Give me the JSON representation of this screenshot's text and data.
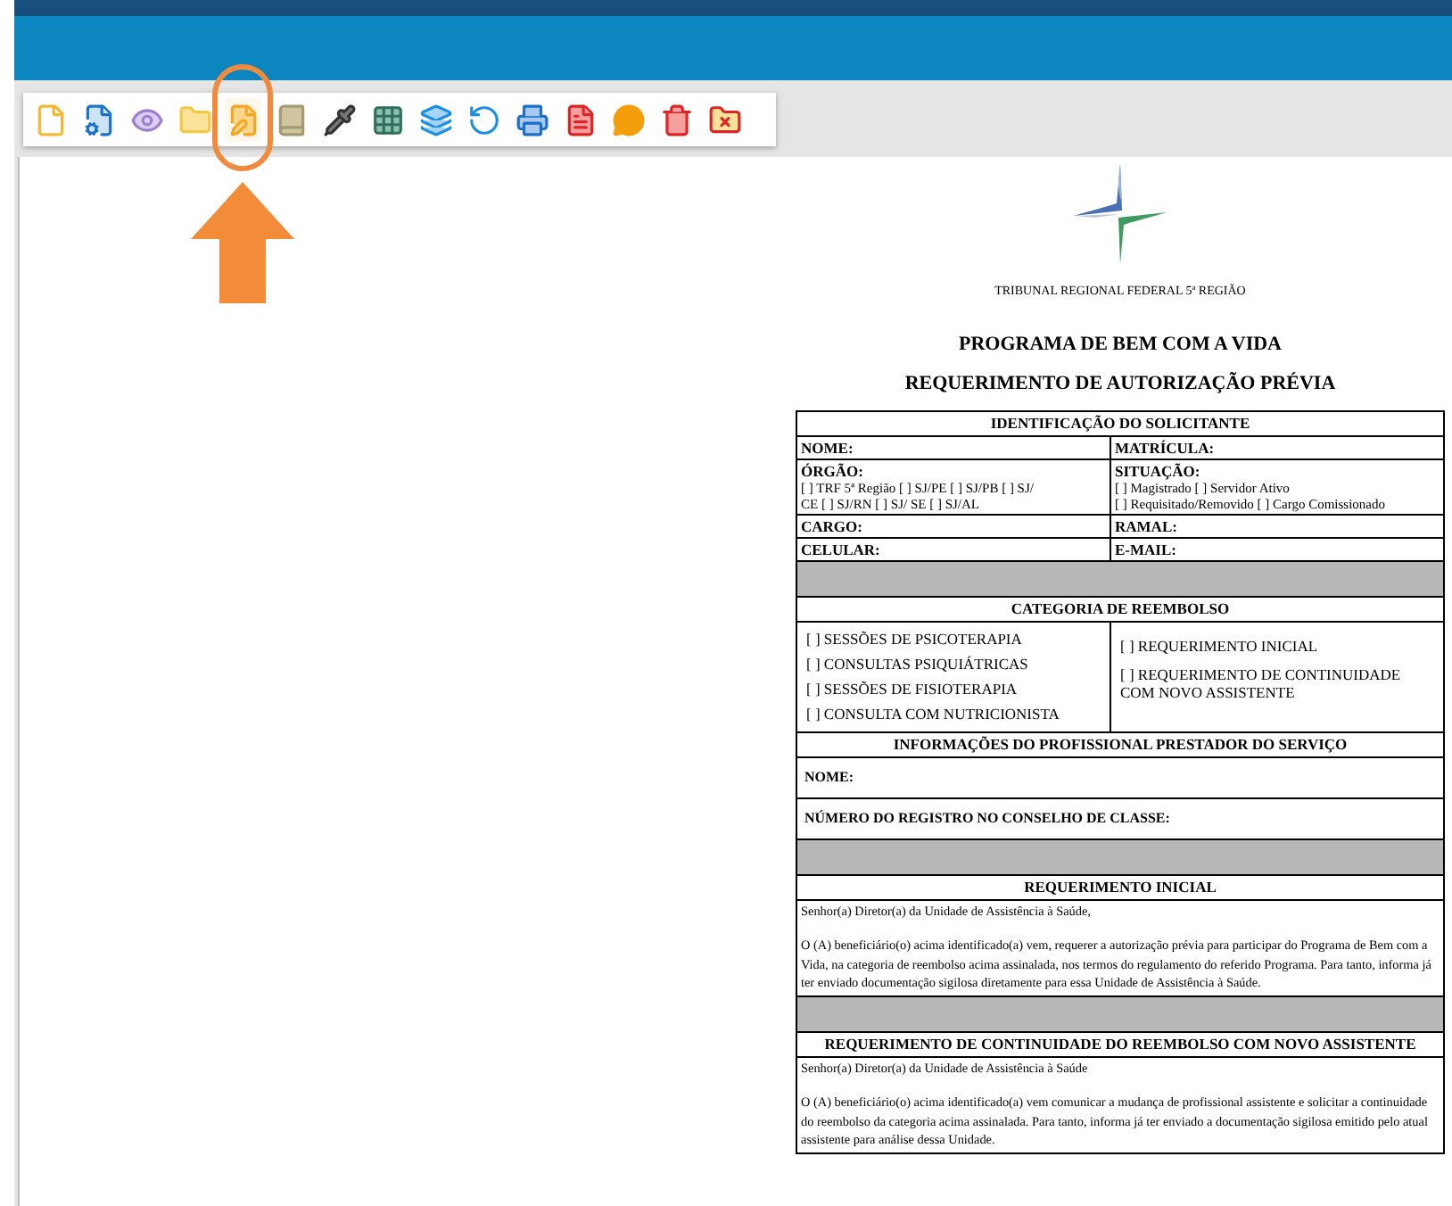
{
  "toolbar": {
    "items": [
      {
        "kind": "new",
        "highlighted": false
      },
      {
        "kind": "settings",
        "highlighted": false
      },
      {
        "kind": "view",
        "highlighted": false
      },
      {
        "kind": "folder-info",
        "highlighted": false
      },
      {
        "kind": "edit",
        "highlighted": true
      },
      {
        "kind": "book",
        "highlighted": false
      },
      {
        "kind": "pipette",
        "highlighted": false
      },
      {
        "kind": "pipette-grid",
        "highlighted": false
      },
      {
        "kind": "layers",
        "highlighted": false
      },
      {
        "kind": "refresh",
        "highlighted": false
      },
      {
        "kind": "print",
        "highlighted": false
      },
      {
        "kind": "pdf",
        "highlighted": false
      },
      {
        "kind": "comment",
        "highlighted": false
      },
      {
        "kind": "delete",
        "highlighted": false
      },
      {
        "kind": "folder-remove",
        "highlighted": false
      }
    ]
  },
  "document": {
    "org": "TRIBUNAL REGIONAL FEDERAL 5ª REGIÃO",
    "title": "PROGRAMA DE BEM COM A VIDA",
    "subtitle": "REQUERIMENTO DE AUTORIZAÇÃO PRÉVIA",
    "sections": [
      {
        "kind": "header",
        "text": "IDENTIFICAÇÃO DO SOLICITANTE"
      },
      {
        "kind": "pair",
        "left": {
          "label": "NOME:"
        },
        "right": {
          "label": "MATRÍCULA:"
        }
      },
      {
        "kind": "pair",
        "left": {
          "label": "ÓRGÃO:",
          "lines": [
            "[ ] TRF 5ª Região [ ] SJ/PE [ ] SJ/PB [ ] SJ/",
            "CE [ ] SJ/RN [ ] SJ/ SE [ ] SJ/AL"
          ]
        },
        "right": {
          "label": "SITUAÇÃO:",
          "lines": [
            "[ ] Magistrado  [ ] Servidor Ativo",
            "[ ] Requisitado/Removido [ ] Cargo Comissionado"
          ]
        }
      },
      {
        "kind": "pair",
        "left": {
          "label": "CARGO:"
        },
        "right": {
          "label": "RAMAL:"
        }
      },
      {
        "kind": "pair",
        "left": {
          "label": "CELULAR:"
        },
        "right": {
          "label": "E-MAIL:"
        }
      },
      {
        "kind": "shaded"
      },
      {
        "kind": "header",
        "text": "CATEGORIA DE REEMBOLSO"
      },
      {
        "kind": "options",
        "left": [
          "[ ] SESSÕES DE PSICOTERAPIA",
          "[ ] CONSULTAS PSIQUIÁTRICAS",
          "[ ] SESSÕES DE FISIOTERAPIA",
          "[ ] CONSULTA COM NUTRICIONISTA"
        ],
        "right": [
          "[ ] REQUERIMENTO INICIAL",
          "[ ] REQUERIMENTO DE CONTINUIDADE COM NOVO ASSISTENTE"
        ]
      },
      {
        "kind": "header",
        "text": "INFORMAÇÕES DO PROFISSIONAL PRESTADOR DO SERVIÇO"
      },
      {
        "kind": "field",
        "label": "NOME:"
      },
      {
        "kind": "field",
        "label": "NÚMERO DO REGISTRO NO CONSELHO DE CLASSE:"
      },
      {
        "kind": "shaded"
      },
      {
        "kind": "header",
        "text": "REQUERIMENTO INICIAL"
      },
      {
        "kind": "text",
        "paragraphs": [
          "Senhor(a) Diretor(a) da Unidade de Assistência à Saúde,",
          "O (A) beneficiário(o) acima identificado(a) vem, requerer a autorização prévia para participar do Programa de Bem com a Vida, na categoria de reembolso acima assinalada, nos termos do regulamento do referido Programa. Para tanto, informa já ter enviado documentação sigilosa diretamente para essa Unidade de Assistência à Saúde."
        ]
      },
      {
        "kind": "shaded"
      },
      {
        "kind": "header",
        "text": "REQUERIMENTO DE CONTINUIDADE DO REEMBOLSO COM NOVO ASSISTENTE"
      },
      {
        "kind": "text",
        "paragraphs": [
          "Senhor(a) Diretor(a) da Unidade de Assistência à Saúde",
          "O (A) beneficiário(o) acima identificado(a) vem comunicar a mudança de profissional assistente e solicitar a continuidade do reembolso da categoria acima assinalada. Para tanto, informa já ter enviado a documentação sigilosa emitido pelo atual assistente para análise dessa Unidade."
        ]
      }
    ]
  }
}
